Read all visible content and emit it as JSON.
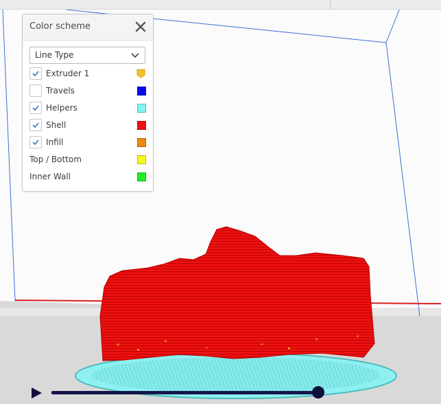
{
  "color_scheme": {
    "title": "Color scheme",
    "close_icon": "close-icon",
    "dropdown": {
      "selected": "Line Type",
      "icon": "chevron-down-icon"
    },
    "items": [
      {
        "label": "Extruder 1",
        "checked": true,
        "has_checkbox": true,
        "color": "#f2c22a",
        "swatch": "extruder-drop"
      },
      {
        "label": "Travels",
        "checked": false,
        "has_checkbox": true,
        "color": "#0a0af0"
      },
      {
        "label": "Helpers",
        "checked": true,
        "has_checkbox": true,
        "color": "#80f5f5"
      },
      {
        "label": "Shell",
        "checked": true,
        "has_checkbox": true,
        "color": "#ee1111"
      },
      {
        "label": "Infill",
        "checked": true,
        "has_checkbox": true,
        "color": "#ee8811"
      },
      {
        "label": "Top / Bottom",
        "has_checkbox": false,
        "color": "#f8f822"
      },
      {
        "label": "Inner Wall",
        "has_checkbox": false,
        "color": "#22ee22"
      }
    ]
  },
  "playback": {
    "play_icon": "play-icon",
    "layer_progress": 1.0
  },
  "colors": {
    "checkmark": "#2f68c4",
    "build_volume_line": "#3a6fd8",
    "floor": "#d9d9d9",
    "red_axis": "#d42020",
    "slider": "#15154a"
  }
}
